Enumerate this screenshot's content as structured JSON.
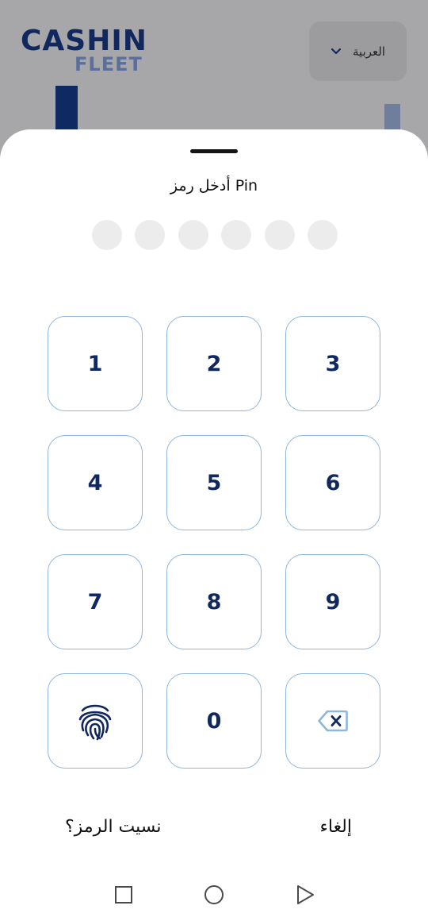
{
  "background_app": {
    "logo_top": "CASHIN",
    "logo_bottom": "FLEET",
    "language_label": "العربية"
  },
  "pin_sheet": {
    "title": "أدخل رمز Pin",
    "dot_count": 6,
    "keys": {
      "k1": "1",
      "k2": "2",
      "k3": "3",
      "k4": "4",
      "k5": "5",
      "k6": "6",
      "k7": "7",
      "k8": "8",
      "k9": "9",
      "k0": "0"
    },
    "forgot_label": "نسيت الرمز؟",
    "cancel_label": "إلغاء"
  },
  "colors": {
    "brand_navy": "#10285e",
    "key_border": "#8fb6dc",
    "dot_empty": "#ececec",
    "backspace_icon": "#8fb6dc"
  },
  "icons": {
    "language_chevron": "chevron-down-icon",
    "biometric": "fingerprint-icon",
    "delete": "backspace-icon",
    "nav_recents": "square-icon",
    "nav_home": "circle-icon",
    "nav_back": "triangle-back-icon"
  }
}
